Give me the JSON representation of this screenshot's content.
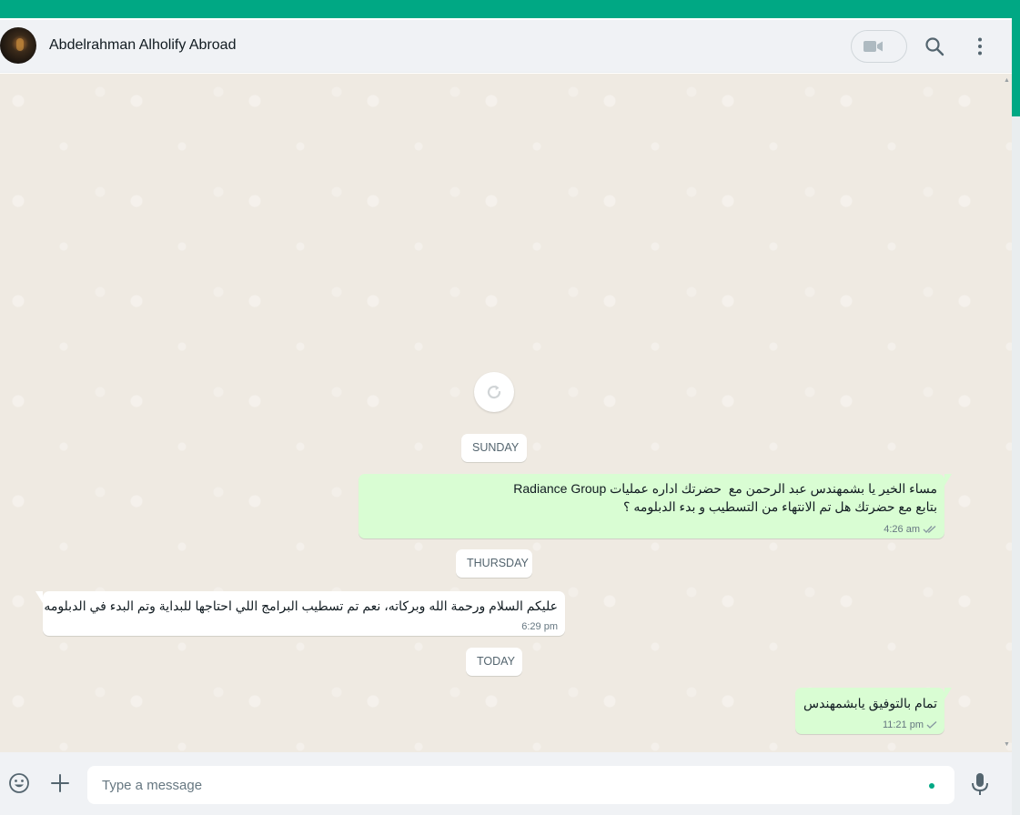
{
  "header": {
    "contact_name": "Abdelrahman Alholify Abroad",
    "icons": [
      "avatar",
      "video-call-icon",
      "chevron-down-icon",
      "search-icon",
      "menu-icon"
    ]
  },
  "chat": {
    "day_separators": {
      "sunday": "SUNDAY",
      "thursday": "THURSDAY",
      "today": "TODAY"
    },
    "messages": [
      {
        "direction": "outgoing",
        "text": "مساء الخير يا بشمهندس عبد الرحمن مع  حضرتك اداره عمليات Radiance Group\nبتابع مع حضرتك هل تم الانتهاء من التسطيب و بدء الدبلومه ؟",
        "time": "4:26 am",
        "status": "read"
      },
      {
        "direction": "incoming",
        "text": "عليكم السلام ورحمة الله وبركاته، نعم تم تسطيب البرامج اللي احتاجها للبداية وتم البدء في الدبلومه",
        "time": "6:29 pm"
      },
      {
        "direction": "outgoing",
        "text": "تمام بالتوفيق يابشمهندس",
        "time": "11:21 pm",
        "status": "sent"
      }
    ]
  },
  "footer": {
    "placeholder": "Type a message"
  },
  "colors": {
    "accent": "#00a884",
    "outgoing_bubble": "#d9fdd3",
    "incoming_bubble": "#ffffff",
    "chat_background": "#efeae2"
  }
}
